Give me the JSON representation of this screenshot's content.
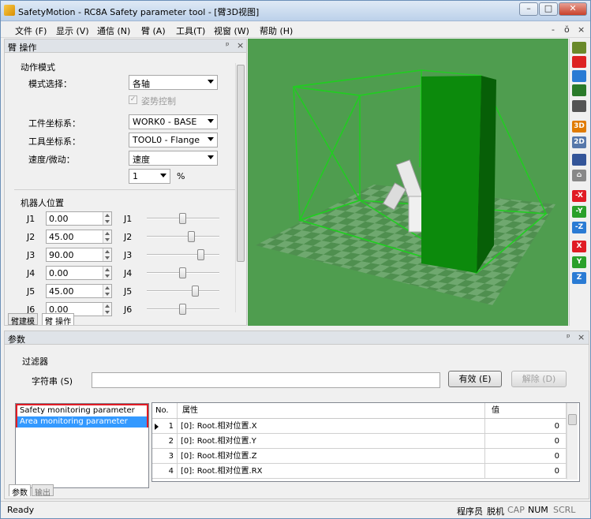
{
  "window": {
    "title": "SafetyMotion - RC8A Safety parameter tool - [臂3D视图]",
    "minimize": "–",
    "maximize": "□",
    "close": "✕"
  },
  "menubar": {
    "items": [
      "文件 (F)",
      "显示 (V)",
      "通信 (N)",
      "臂 (A)",
      "工具(T)",
      "视窗 (W)",
      "帮助 (H)"
    ],
    "mdi_controls": [
      "-",
      "ŏ",
      "×"
    ]
  },
  "arm_panel": {
    "title": "臂 操作",
    "pin": "ᵖ",
    "close": "×",
    "motion_group": "动作模式",
    "mode_label": "模式选择：",
    "mode_value": "各轴",
    "posture_label": "姿势控制",
    "work_coord_label": "工件坐标系：",
    "work_coord_value": "WORK0 - BASE",
    "tool_coord_label": "工具坐标系：",
    "tool_coord_value": "TOOL0 - Flange",
    "speed_label": "速度/微动：",
    "speed_value": "速度",
    "speed_percent": "1",
    "percent_unit": "%",
    "position_group": "机器人位置",
    "joints": [
      {
        "label": "J1",
        "value": "0.00",
        "slider_label": "J1",
        "slider_pos": 0.5
      },
      {
        "label": "J2",
        "value": "45.00",
        "slider_label": "J2",
        "slider_pos": 0.62
      },
      {
        "label": "J3",
        "value": "90.00",
        "slider_label": "J3",
        "slider_pos": 0.75
      },
      {
        "label": "J4",
        "value": "0.00",
        "slider_label": "J4",
        "slider_pos": 0.5
      },
      {
        "label": "J5",
        "value": "45.00",
        "slider_label": "J5",
        "slider_pos": 0.67
      },
      {
        "label": "J6",
        "value": "0.00",
        "slider_label": "J6",
        "slider_pos": 0.5
      }
    ],
    "tabs": [
      "臂建模",
      "臂 操作"
    ]
  },
  "right_toolbar": {
    "buttons": [
      {
        "name": "pan-icon",
        "label": "",
        "color": "#6a8a2a"
      },
      {
        "name": "no-entry-icon",
        "label": "",
        "color": "#d22"
      },
      {
        "name": "rotate-icon",
        "label": "",
        "color": "#2a7bd4"
      },
      {
        "name": "center-icon",
        "label": "",
        "color": "#2a7a2a"
      },
      {
        "name": "camera-icon",
        "label": "",
        "color": "#555"
      },
      {
        "name": "view-3d-icon",
        "label": "3D",
        "color": "#e07b00"
      },
      {
        "name": "view-2d-icon",
        "label": "2D",
        "color": "#5577aa"
      },
      {
        "name": "robot-icon",
        "label": "",
        "color": "#335599"
      },
      {
        "name": "home-icon",
        "label": "⌂",
        "color": "#888"
      },
      {
        "name": "x-minus-icon",
        "label": "-X",
        "color": "#e01b24"
      },
      {
        "name": "y-minus-icon",
        "label": "-Y",
        "color": "#2aa02a"
      },
      {
        "name": "z-minus-icon",
        "label": "-Z",
        "color": "#2a7bd4"
      },
      {
        "name": "x-plus-icon",
        "label": "X",
        "color": "#e01b24"
      },
      {
        "name": "y-plus-icon",
        "label": "Y",
        "color": "#2aa02a"
      },
      {
        "name": "z-plus-icon",
        "label": "Z",
        "color": "#2a7bd4"
      }
    ]
  },
  "params_panel": {
    "title": "参数",
    "pin": "ᵖ",
    "close": "×",
    "filter_group": "过滤器",
    "string_label": "字符串 (S)",
    "string_value": "",
    "valid_button": "有效 (E)",
    "clear_button": "解除 (D)",
    "list_items": [
      "Safety monitoring parameter",
      "Area monitoring parameter"
    ],
    "selected_index": 1,
    "grid_headers": [
      "No.",
      "属性",
      "值"
    ],
    "rows": [
      {
        "no": "1",
        "attr": "[0]: Root.相对位置.X",
        "value": "0"
      },
      {
        "no": "2",
        "attr": "[0]: Root.相对位置.Y",
        "value": "0"
      },
      {
        "no": "3",
        "attr": "[0]: Root.相对位置.Z",
        "value": "0"
      },
      {
        "no": "4",
        "attr": "[0]: Root.相对位置.RX",
        "value": "0"
      }
    ],
    "tabs": [
      "参数",
      "输出"
    ]
  },
  "statusbar": {
    "ready": "Ready",
    "indicators": [
      "程序员",
      "脱机",
      "CAP",
      "NUM",
      "SCRL"
    ]
  },
  "colors": {
    "ground_light": "#6fa86f",
    "ground_dark": "#4f8f4f",
    "zone_wall": "#0c8a0c",
    "wire": "#22cc22",
    "highlight_red": "#e01b24",
    "selection": "#3399ff"
  }
}
